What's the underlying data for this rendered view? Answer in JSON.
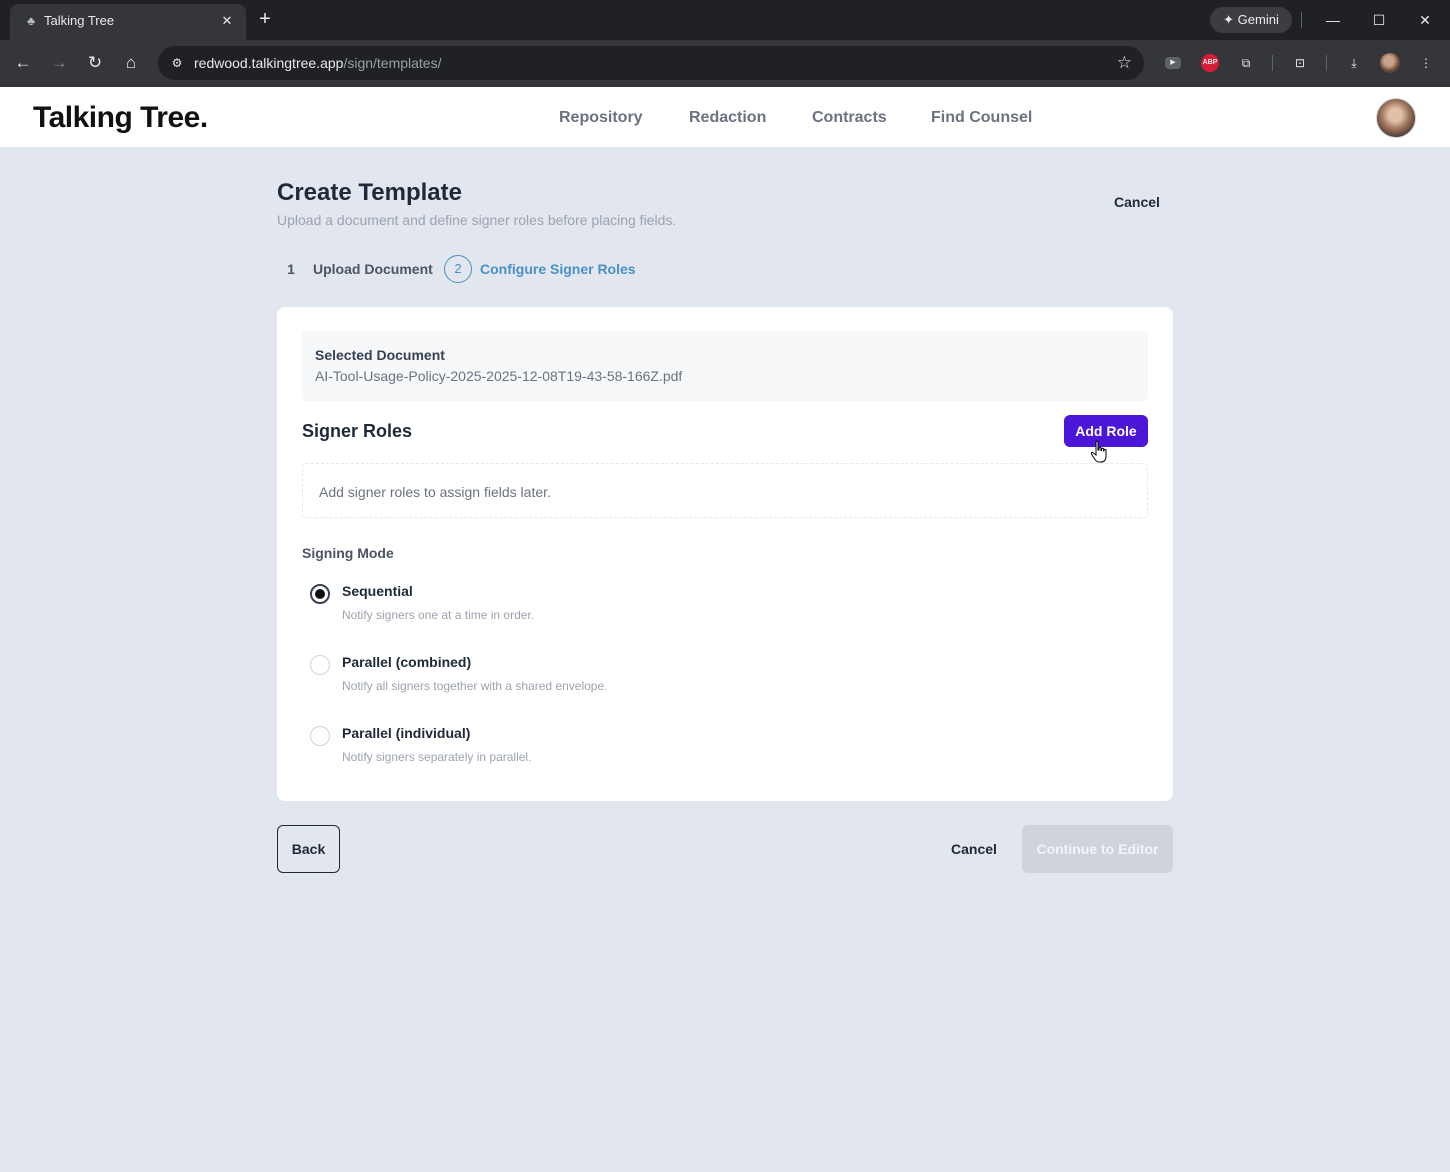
{
  "browser": {
    "tab_title": "Talking Tree",
    "gemini_label": "Gemini",
    "url_host": "redwood.talkingtree.app",
    "url_path": "/sign/templates/",
    "abp_label": "ABP"
  },
  "app": {
    "logo": "Talking Tree.",
    "nav": [
      "Repository",
      "Redaction",
      "Contracts",
      "Find Counsel"
    ]
  },
  "page": {
    "title": "Create Template",
    "subtitle": "Upload a document and define signer roles before placing fields.",
    "cancel_label": "Cancel"
  },
  "steps": [
    {
      "number": "1",
      "label": "Upload Document",
      "active": false
    },
    {
      "number": "2",
      "label": "Configure Signer Roles",
      "active": true
    }
  ],
  "document": {
    "label": "Selected Document",
    "filename": "AI-Tool-Usage-Policy-2025-2025-12-08T19-43-58-166Z.pdf"
  },
  "signer_roles": {
    "title": "Signer Roles",
    "add_button": "Add Role",
    "empty_text": "Add signer roles to assign fields later."
  },
  "signing_mode": {
    "title": "Signing Mode",
    "selected": "Sequential",
    "options": [
      {
        "label": "Sequential",
        "description": "Notify signers one at a time in order."
      },
      {
        "label": "Parallel (combined)",
        "description": "Notify all signers together with a shared envelope."
      },
      {
        "label": "Parallel (individual)",
        "description": "Notify signers separately in parallel."
      }
    ]
  },
  "footer": {
    "back_label": "Back",
    "cancel_label": "Cancel",
    "continue_label": "Continue to Editor"
  },
  "colors": {
    "primary": "#4c16d9",
    "step_active": "#4a90c8",
    "page_bg": "#e2e6ee"
  }
}
